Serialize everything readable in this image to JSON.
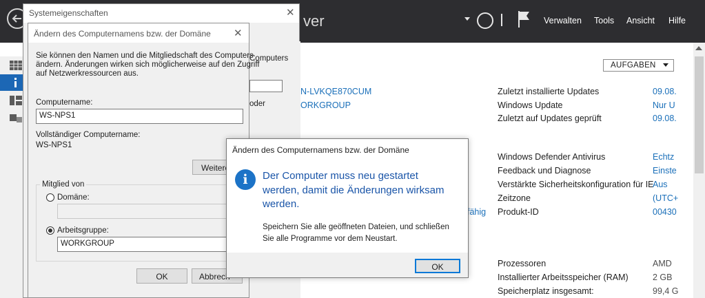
{
  "server_manager": {
    "title_partial": "ver",
    "menu": [
      "Verwalten",
      "Tools",
      "Ansicht",
      "Hilfe"
    ],
    "tasks_label": "AUFGABEN",
    "left_values": [
      {
        "text": "N-LVKQE870CUM"
      },
      {
        "text": "ORKGROUP"
      },
      {
        "text": "fähig"
      }
    ],
    "properties": [
      {
        "label": "Zuletzt installierte Updates",
        "value": "09.08."
      },
      {
        "label": "Windows Update",
        "value": "Nur U"
      },
      {
        "label": "Zuletzt auf Updates geprüft",
        "value": "09.08."
      },
      {
        "label": "Windows Defender Antivirus",
        "value": "Echtz"
      },
      {
        "label": "Feedback und Diagnose",
        "value": "Einste"
      },
      {
        "label": "Verstärkte Sicherheitskonfiguration für IE",
        "value": "Aus"
      },
      {
        "label": "Zeitzone",
        "value": "(UTC+"
      },
      {
        "label": "Produkt-ID",
        "value": "00430"
      },
      {
        "label": "Prozessoren",
        "value": "AMD"
      },
      {
        "label": "Installierter Arbeitsspeicher (RAM)",
        "value": "2 GB"
      },
      {
        "label": "Speicherplatz insgesamt:",
        "value": "99,4 G"
      }
    ]
  },
  "system_properties": {
    "title": "Systemeigenschaften",
    "partial_text_1": "Computers",
    "partial_text_2": "oder"
  },
  "computer_name_dialog": {
    "title": "Ändern des Computernamens bzw. der Domäne",
    "intro_line1": "Sie können den Namen und die Mitgliedschaft des Computers",
    "intro_line2": "ändern. Änderungen wirken sich möglicherweise auf den Zugriff",
    "intro_line3": "auf Netzwerkressourcen aus.",
    "computer_name_label": "Computername:",
    "computer_name_value": "WS-NPS1",
    "full_name_label": "Vollständiger Computername:",
    "full_name_value": "WS-NPS1",
    "more_button": "Weitere",
    "member_of_label": "Mitglied von",
    "domain_label": "Domäne:",
    "domain_value": "",
    "workgroup_label": "Arbeitsgruppe:",
    "workgroup_value": "WORKGROUP",
    "ok_label": "OK",
    "cancel_label": "Abbrech"
  },
  "message_box": {
    "title": "Ändern des Computernamens bzw. der Domäne",
    "main_line1": "Der Computer muss neu gestartet",
    "main_line2": "werden, damit die Änderungen wirksam",
    "main_line3": "werden.",
    "sub_line1": "Speichern Sie alle geöffneten Dateien, und schließen",
    "sub_line2": "Sie alle Programme vor dem Neustart.",
    "ok_label": "OK"
  },
  "colors": {
    "header_bg": "#2d2d30",
    "accent_blue": "#1a6fb9",
    "message_blue": "#1a55a8",
    "default_button_border": "#0078d7"
  }
}
